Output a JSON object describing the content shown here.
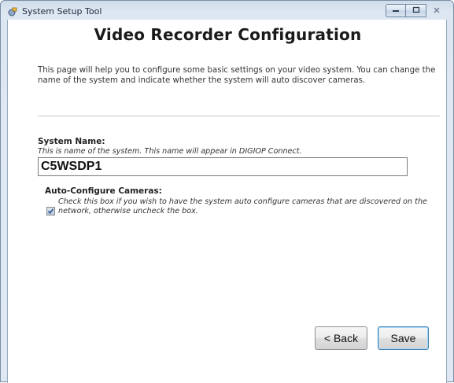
{
  "window": {
    "title": "System Setup Tool",
    "minimize_icon": "minimize-icon",
    "maximize_icon": "maximize-icon",
    "close_icon": "close-icon"
  },
  "page": {
    "title": "Video Recorder Configuration",
    "intro": "This page will help you to configure some basic settings on your video system. You can change the name of the system and indicate whether the system will auto discover cameras."
  },
  "system_name": {
    "label": "System Name:",
    "help": "This is name of the system. This name will appear in DIGIOP Connect.",
    "value": "C5WSDP1"
  },
  "auto_configure": {
    "label": "Auto-Configure Cameras:",
    "help": "Check this box if you wish to have the system auto configure cameras that are discovered on the network, otherwise uncheck the box.",
    "checked": true
  },
  "buttons": {
    "back_label": "< Back",
    "save_label": "Save"
  },
  "colors": {
    "titlebar": "#dde7f2",
    "accent_border": "#3c7fb1"
  }
}
